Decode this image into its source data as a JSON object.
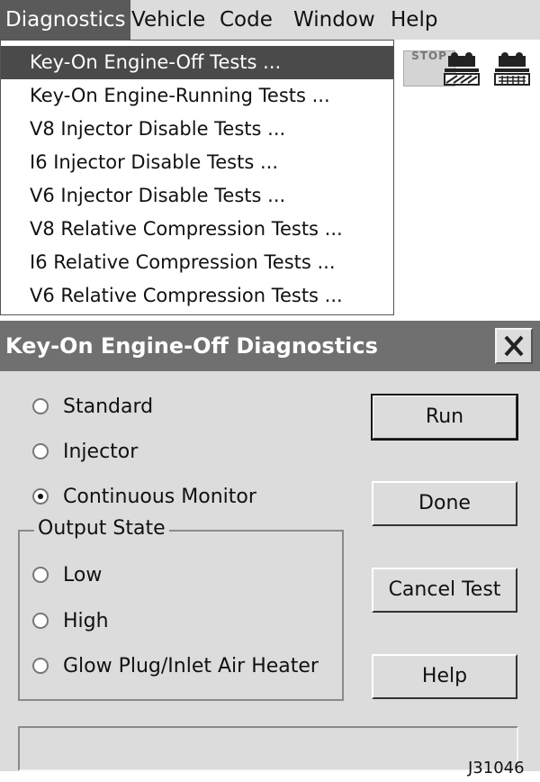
{
  "menubar": {
    "items": [
      "Diagnostics",
      "Vehicle",
      "Code",
      "Window",
      "Help"
    ]
  },
  "toolbar": {
    "stop_label": "STOP",
    "icons": [
      "vehicle-test-icon",
      "vehicle-keypad-icon"
    ]
  },
  "dropdown": {
    "items": [
      "Key-On Engine-Off Tests ...",
      "Key-On Engine-Running Tests ...",
      "V8 Injector Disable Tests ...",
      "I6 Injector Disable Tests ...",
      "V6 Injector Disable Tests ...",
      "V8 Relative Compression Tests ...",
      "I6 Relative Compression Tests ...",
      "V6 Relative Compression Tests ..."
    ],
    "highlighted": 0
  },
  "dialog": {
    "title": "Key-On Engine-Off Diagnostics",
    "close_icon": "close-icon",
    "test_options": [
      {
        "label": "Standard",
        "checked": false
      },
      {
        "label": "Injector",
        "checked": false
      },
      {
        "label": "Continuous Monitor",
        "checked": true
      }
    ],
    "output_state": {
      "title": "Output State",
      "options": [
        {
          "label": "Low",
          "checked": false
        },
        {
          "label": "High",
          "checked": false
        },
        {
          "label": "Glow Plug/Inlet Air Heater",
          "checked": false
        }
      ]
    },
    "buttons": {
      "run": "Run",
      "done": "Done",
      "cancel": "Cancel Test",
      "help": "Help"
    }
  },
  "figure_label": "J31046",
  "colors": {
    "menu_bg": "#dcdcdc",
    "highlight": "#4a4a4a",
    "titlebar": "#707070",
    "dialog_bg": "#dcdcdc"
  }
}
